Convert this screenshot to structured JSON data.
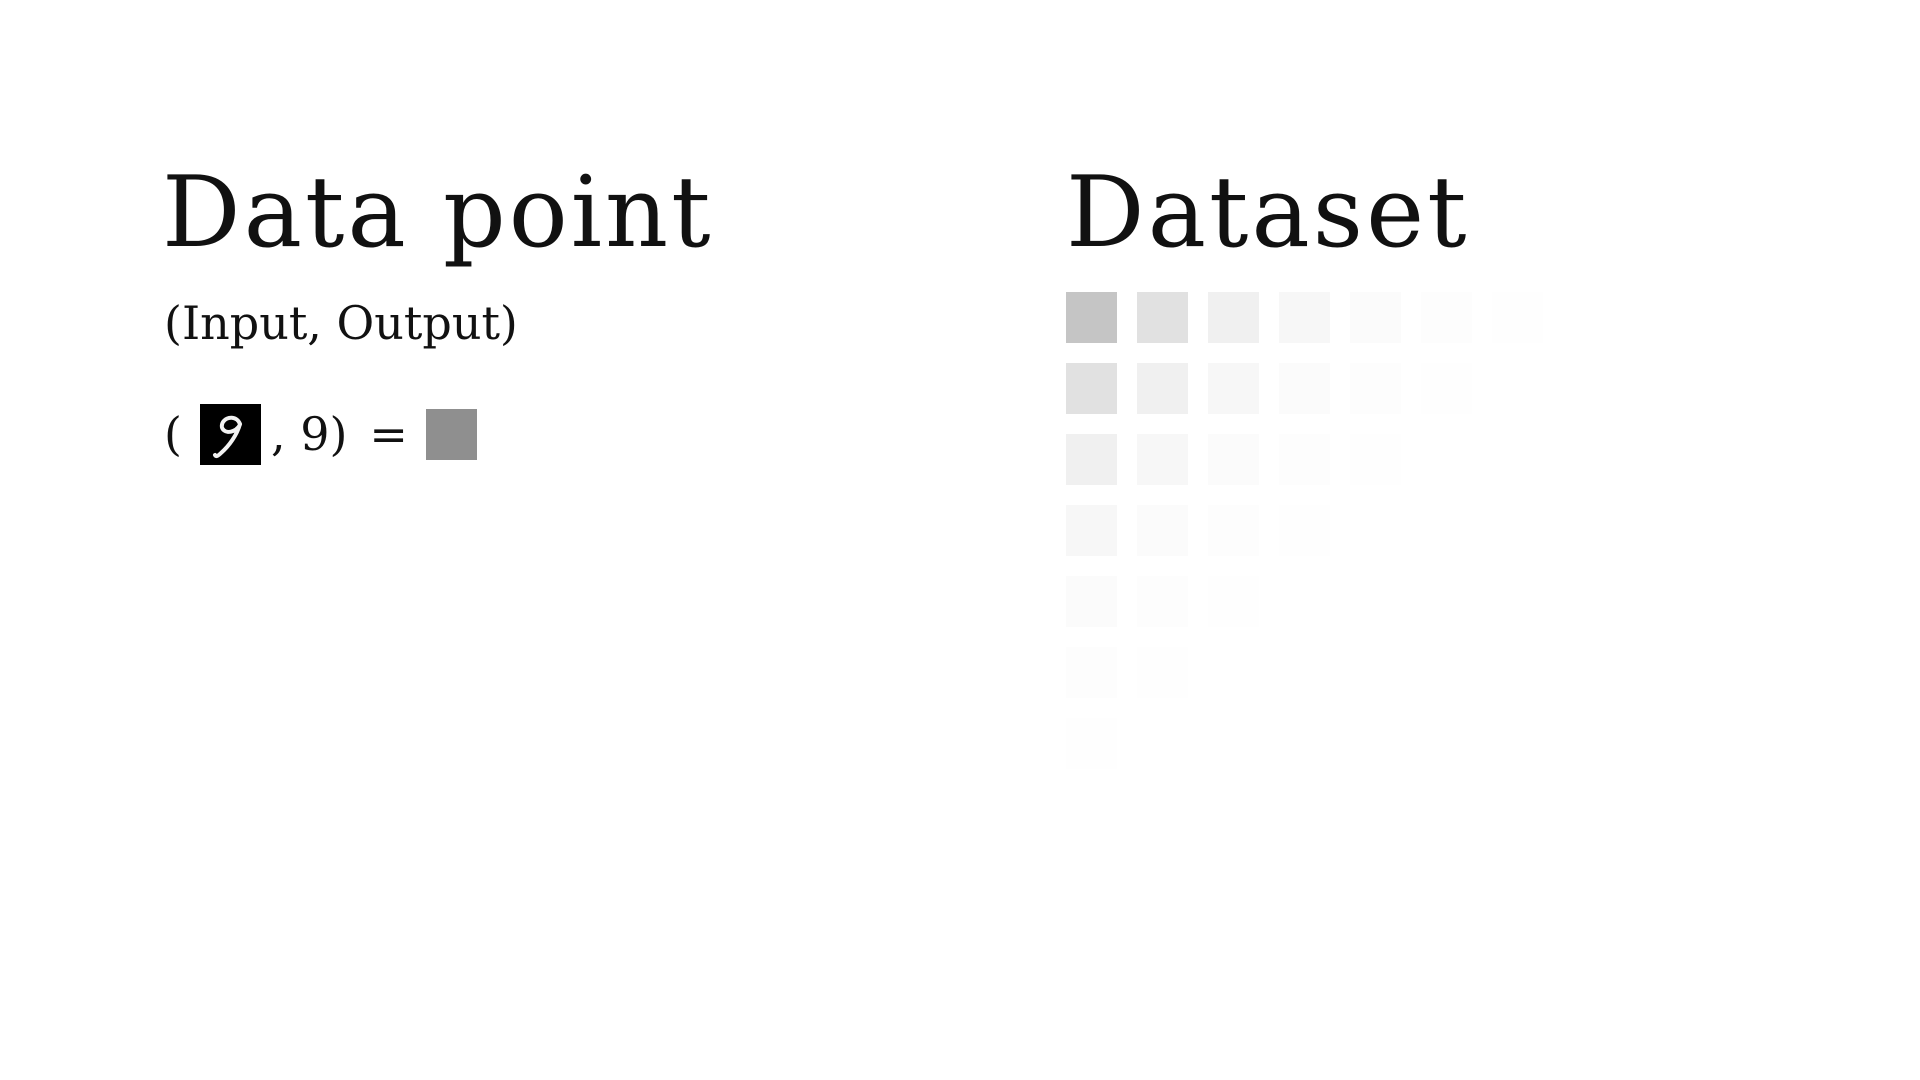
{
  "data_point": {
    "title": "Data point",
    "subtitle": "(Input, Output)",
    "equation": {
      "open": "(",
      "input_image_icon": "handwritten-digit-9-icon",
      "rest": ", 9)",
      "equals": "=",
      "output_swatch_color": "#8f8f8f"
    }
  },
  "dataset": {
    "title": "Dataset",
    "cell_base_color": "#8f8f8f",
    "row_lengths": [
      7,
      6,
      5,
      4,
      3,
      2,
      1
    ]
  }
}
